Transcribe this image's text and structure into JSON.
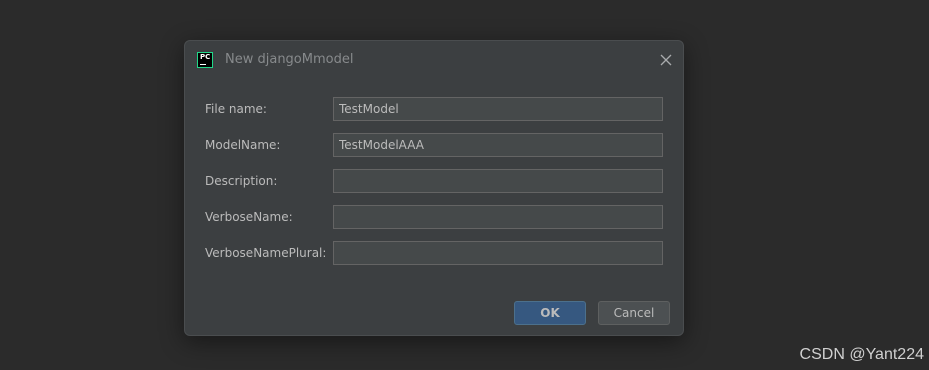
{
  "dialog": {
    "title": "New djangoMmodel",
    "app_icon": "pycharm-icon",
    "close_icon": "close-icon",
    "fields": [
      {
        "label": "File name:",
        "value": "TestModel",
        "placeholder": ""
      },
      {
        "label": "ModelName:",
        "value": "TestModelAAA",
        "placeholder": ""
      },
      {
        "label": "Description:",
        "value": "",
        "placeholder": ""
      },
      {
        "label": "VerboseName:",
        "value": "",
        "placeholder": ""
      },
      {
        "label": "VerboseNamePlural:",
        "value": "",
        "placeholder": ""
      }
    ],
    "ok_label": "OK",
    "cancel_label": "Cancel"
  },
  "watermark": "CSDN @Yant224",
  "colors": {
    "background": "#2b2b2b",
    "dialog": "#3c3f41",
    "ok_button": "#365880",
    "input_bg": "#45494a"
  }
}
